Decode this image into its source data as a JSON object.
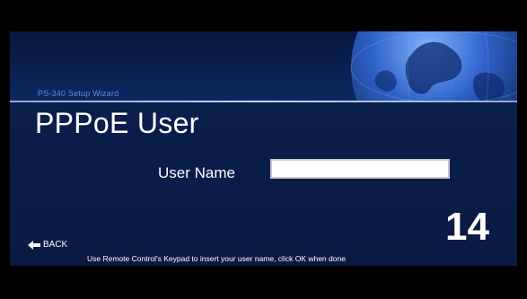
{
  "wizard": {
    "label": "PS-340 Setup Wizard",
    "title": "PPPoE User",
    "step_number": "14"
  },
  "form": {
    "user_name_label": "User Name",
    "user_name_value": "",
    "user_name_placeholder": ""
  },
  "footer": {
    "back_label": "BACK",
    "back_icon": "arrow-left-icon",
    "hint": "Use Remote Control's Keypad to insert your user name, click OK when done"
  },
  "colors": {
    "background": "#0a1b45",
    "header_accent": "#5f8fe0",
    "text": "#ffffff",
    "frame": "#000000"
  }
}
